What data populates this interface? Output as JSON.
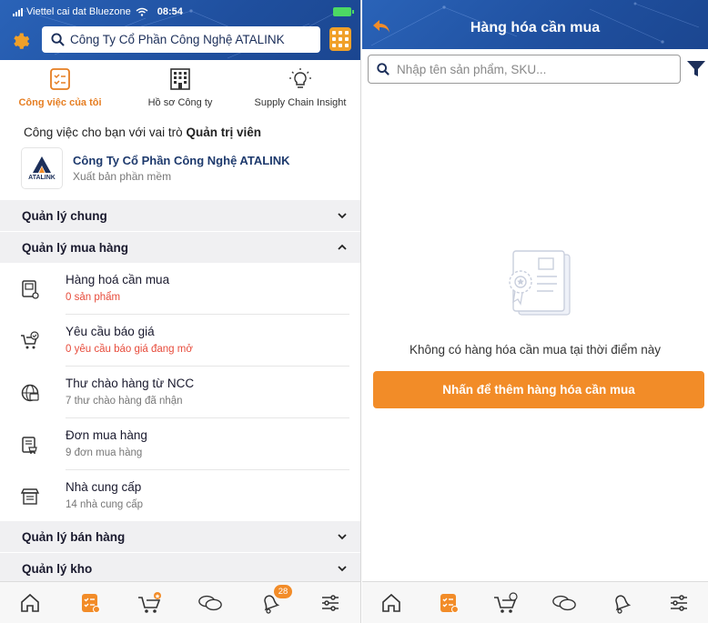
{
  "colors": {
    "header_blue": "#1f4f9e",
    "accent_orange": "#f28c28",
    "active_tab": "#e67e22",
    "link_red": "#e74c3c"
  },
  "left": {
    "status": {
      "carrier": "Viettel cai dat Bluezone",
      "time": "08:54"
    },
    "search_text": "Công Ty Cổ Phần Công Nghệ ATALINK",
    "tabs": [
      {
        "label": "Công việc của tôi",
        "icon": "task-list-icon",
        "active": true
      },
      {
        "label": "Hồ sơ Công ty",
        "icon": "building-icon",
        "active": false
      },
      {
        "label": "Supply Chain Insight",
        "icon": "lightbulb-icon",
        "active": false
      }
    ],
    "role_prefix": "Công việc cho bạn với vai trò ",
    "role_name": "Quản trị viên",
    "company": {
      "logo_text": "ATALINK",
      "name": "Công Ty Cổ Phần Công Nghệ ATALINK",
      "subtitle": "Xuất bản phần mềm"
    },
    "sections": {
      "general": "Quản lý chung",
      "purchasing": "Quản lý mua hàng",
      "sales": "Quản lý bán hàng",
      "warehouse": "Quản lý kho"
    },
    "purchase_items": [
      {
        "title": "Hàng hoá cần mua",
        "subtitle": "0 sản phẩm",
        "icon": "goods-list-icon"
      },
      {
        "title": "Yêu cầu báo giá",
        "subtitle": "0 yêu cầu báo giá đang mở",
        "icon": "cart-quote-icon"
      },
      {
        "title": "Thư chào hàng từ NCC",
        "subtitle": "7 thư chào hàng đã nhận",
        "icon": "offer-globe-icon"
      },
      {
        "title": "Đơn mua hàng",
        "subtitle": "9 đơn mua hàng",
        "icon": "purchase-order-icon"
      },
      {
        "title": "Nhà cung cấp",
        "subtitle": "14 nhà cung cấp",
        "icon": "supplier-store-icon"
      }
    ],
    "bottom_nav": [
      {
        "icon": "home-icon"
      },
      {
        "icon": "tasks-icon",
        "active": true
      },
      {
        "icon": "marketplace-cart-icon"
      },
      {
        "icon": "chat-icon"
      },
      {
        "icon": "notification-bell-icon",
        "badge": "28"
      },
      {
        "icon": "settings-sliders-icon"
      }
    ]
  },
  "right": {
    "title": "Hàng hóa cần mua",
    "search_placeholder": "Nhập tên sản phẩm, SKU...",
    "empty_text": "Không có hàng hóa cần mua tại thời điểm này",
    "add_button": "Nhấn để thêm hàng hóa cần mua"
  }
}
